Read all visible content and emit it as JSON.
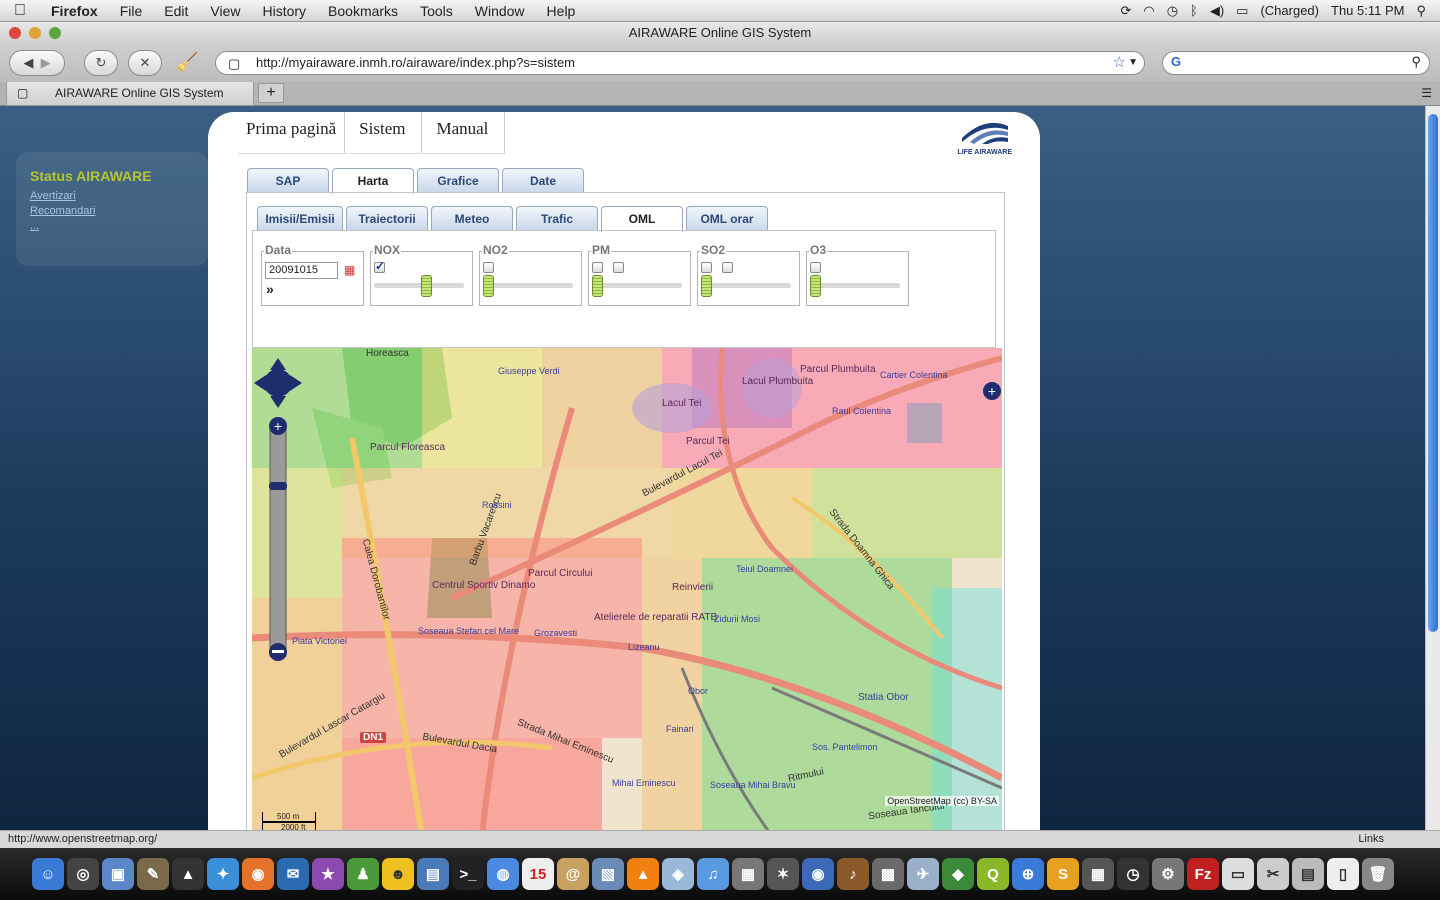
{
  "menubar": {
    "app_name": "Firefox",
    "items": [
      "File",
      "Edit",
      "View",
      "History",
      "Bookmarks",
      "Tools",
      "Window",
      "Help"
    ],
    "battery": "(Charged)",
    "clock": "Thu 5:11 PM"
  },
  "window": {
    "title": "AIRAWARE Online GIS System"
  },
  "toolbar": {
    "url": "http://myairaware.inmh.ro/airaware/index.php?s=sistem",
    "search_value": ""
  },
  "tab": {
    "title": "AIRAWARE Online GIS System",
    "new_tab": "+"
  },
  "sidebar": {
    "title": "Status AIRAWARE",
    "links": [
      "Avertizari",
      "Recomandari",
      "..."
    ]
  },
  "topnav": {
    "items": [
      "Prima pagină",
      "Sistem",
      "Manual"
    ]
  },
  "logo": {
    "text": "LIFE AIRAWARE"
  },
  "main_tabs": [
    "SAP",
    "Harta",
    "Grafice",
    "Date"
  ],
  "main_tabs_active": "Harta",
  "sub_tabs": [
    "Imisii/Emisii",
    "Traiectorii",
    "Meteo",
    "Trafic",
    "OML",
    "OML orar"
  ],
  "sub_tabs_active": "OML",
  "controls": {
    "date_label": "Data",
    "date_value": "20091015",
    "advance_icon": "»",
    "layers": [
      {
        "label": "NOX",
        "checked": true
      },
      {
        "label": "NO2",
        "checked": false
      },
      {
        "label": "PM",
        "checked": false
      },
      {
        "label": "SO2",
        "checked": false
      },
      {
        "label": "O3",
        "checked": false
      }
    ]
  },
  "map": {
    "labels": [
      "Parcul Floreasca",
      "Lacul Tei",
      "Parcul Plumbuita",
      "Lacul Plumbuita",
      "Parcul Tei",
      "Centrul Sportiv Dinamo",
      "Parcul Circului",
      "Reinvierii",
      "Atelierele de reparatii RATB",
      "Statia Obor",
      "Giuseppe Verdi",
      "Cartier Colentina",
      "Raul Colentina",
      "Bulevardul Lacul Tei",
      "Calea Dorobantilor",
      "Soseaua Stefan cel Mare",
      "Bulevardul Dacia",
      "Strada Mihai Eminescu",
      "Strada Doamna Ghica",
      "Bulevardul Lascar Catargiu",
      "Ritmului",
      "Soseaua Iancului",
      "Zidurii Mosi",
      "Teiul Doamnei",
      "Barbu Vacarescu",
      "Horeasca",
      "Rossini",
      "Piata Victoriei",
      "Grozavesti",
      "Lizeanu",
      "Sos. Pantelimon",
      "Obor",
      "Fainari",
      "Mihai Eminescu",
      "Soseaua Mihai Bravu",
      "DN1"
    ],
    "attribution": "OpenStreetMap (cc) BY-SA",
    "scale_metric": "500 m",
    "scale_imperial": "2000 ft"
  },
  "statusbar": {
    "url": "http://www.openstreetmap.org/",
    "links": "Links"
  },
  "colors": {
    "page_bg": "#1b3b5c",
    "tab_text": "#2b4a7a",
    "status_title": "#b6c62c"
  }
}
